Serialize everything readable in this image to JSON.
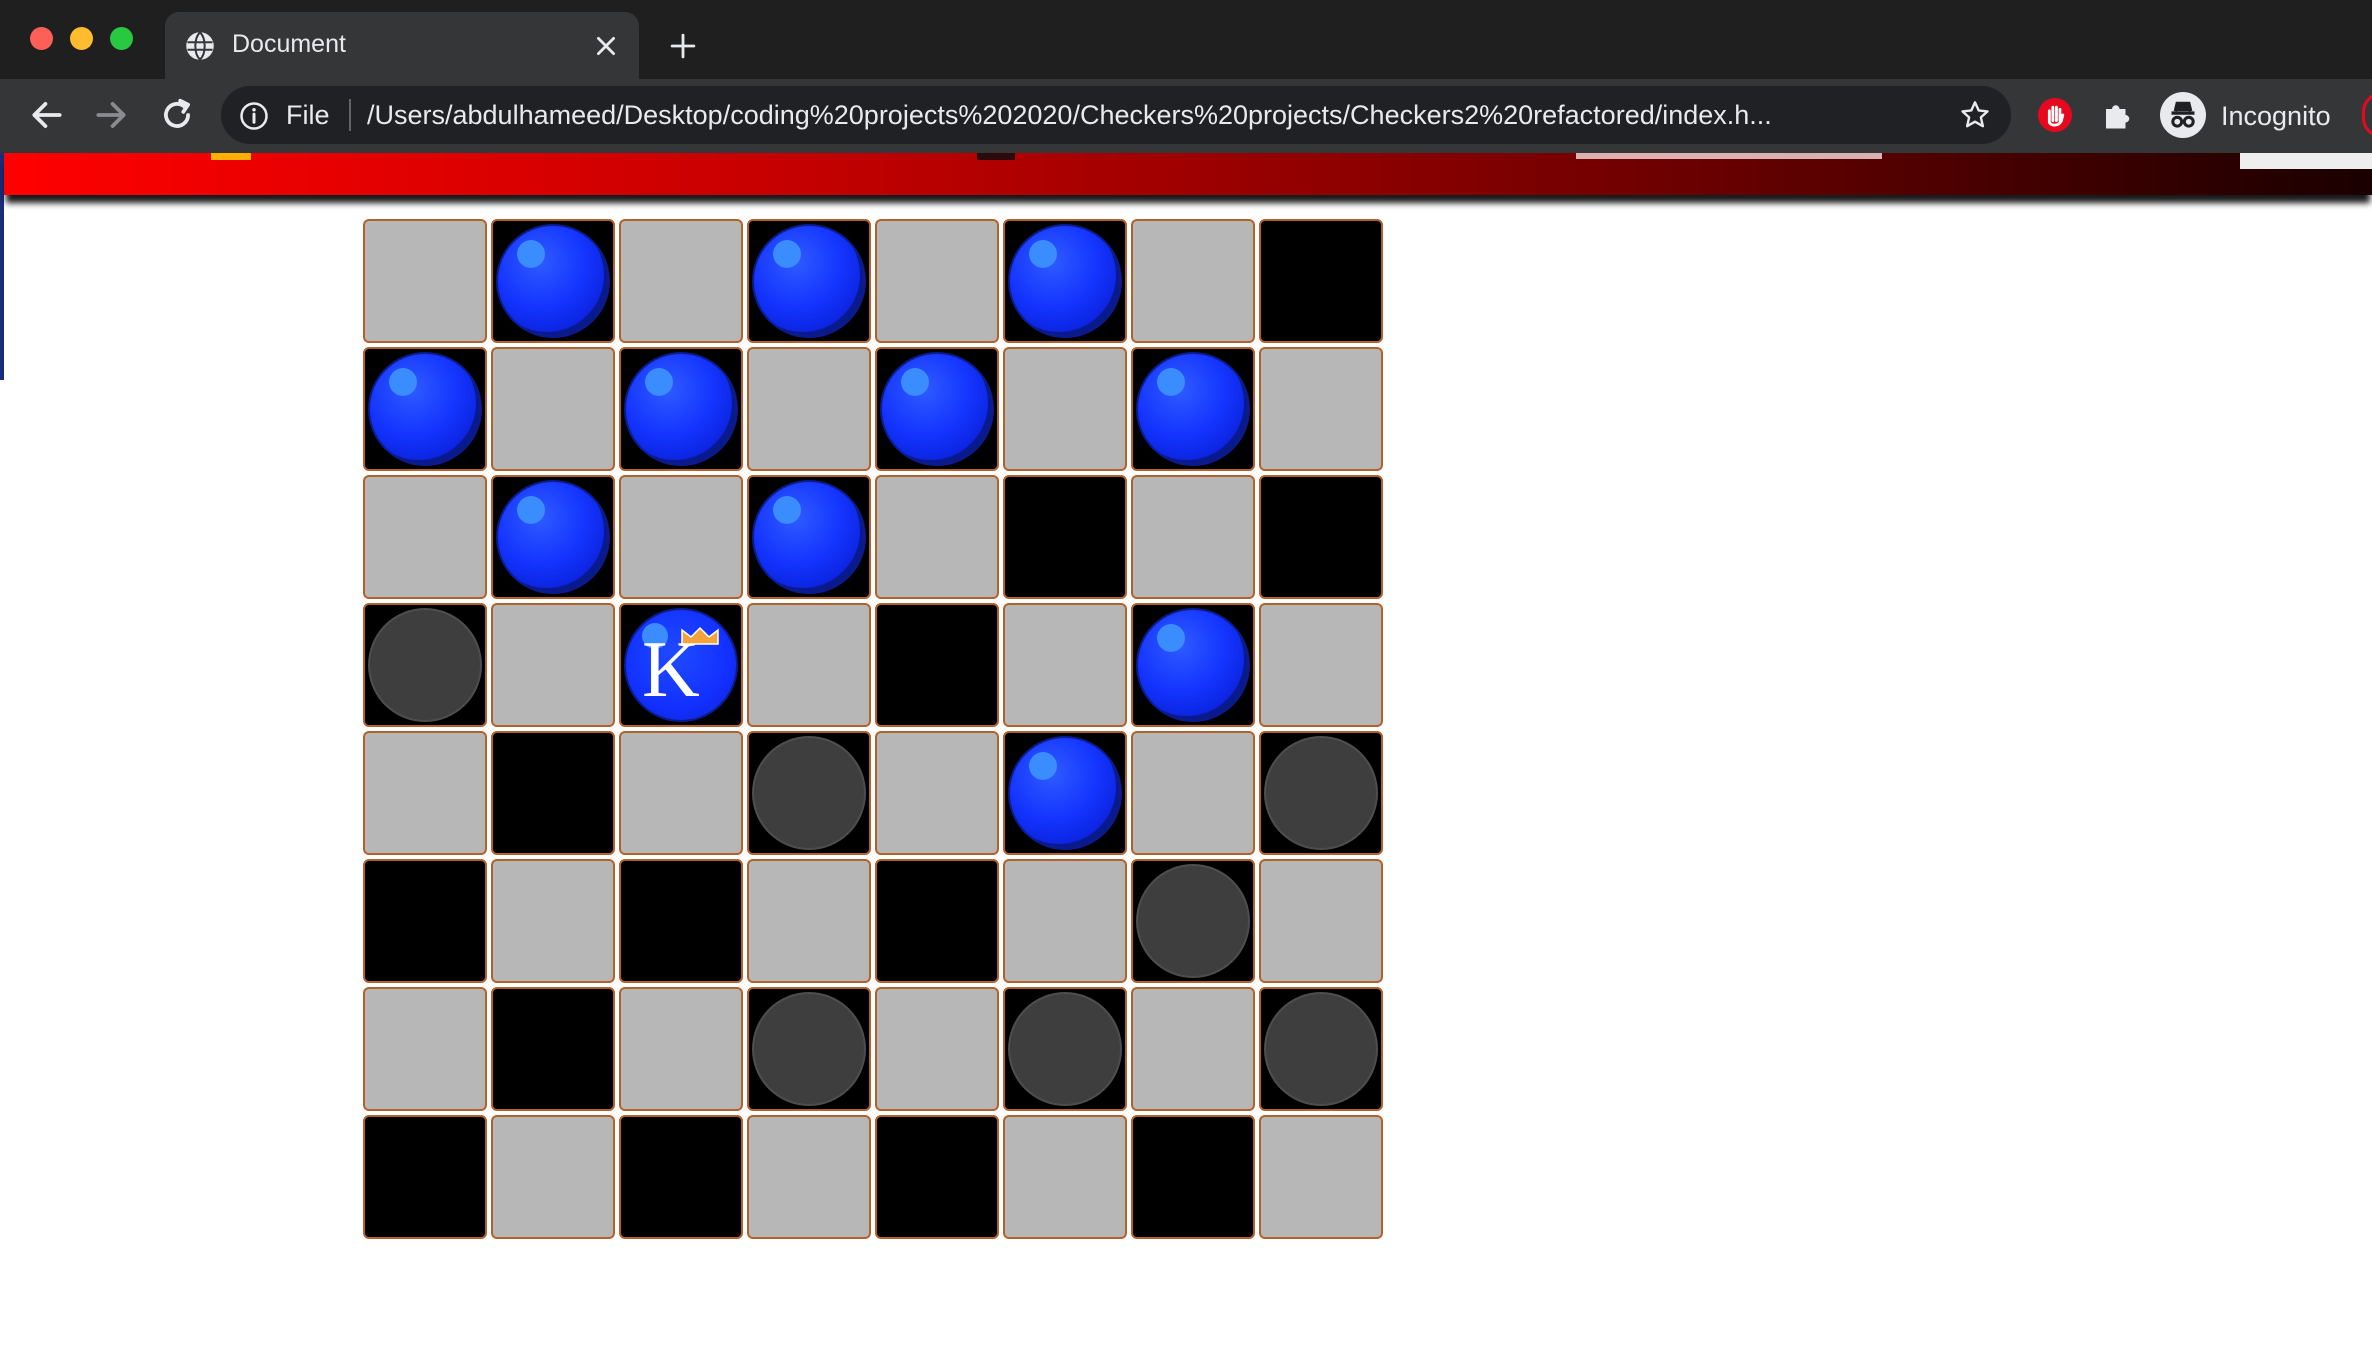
{
  "browser": {
    "tab_title": "Document",
    "url_scheme": "File",
    "url": "/Users/abdulhameed/Desktop/coding%20projects%202020/Checkers%20projects/Checkers2%20refactored/index.h...",
    "incognito_label": "Incognito",
    "icons": {
      "tab": "globe-icon",
      "tab_close": "close-icon",
      "new_tab": "plus-icon",
      "back": "back-arrow-icon",
      "forward": "forward-arrow-icon",
      "reload": "reload-icon",
      "info": "info-icon",
      "bookmark": "star-icon",
      "extension_adblock": "adblock-hand-icon",
      "extensions": "puzzle-icon",
      "incognito": "incognito-icon"
    }
  },
  "colors": {
    "header_gradient_start": "#ff0000",
    "header_gradient_end": "#1a0000",
    "light_square": "#b7b7b7",
    "dark_square": "#000000",
    "square_border": "#b5622a",
    "blue_piece": "#1435ff",
    "grey_piece": "#3e3e3e"
  },
  "board": {
    "rows": [
      [
        "L",
        "D-blue",
        "L",
        "D-blue",
        "L",
        "D-blue",
        "L",
        "D"
      ],
      [
        "D-blue",
        "L",
        "D-blue",
        "L",
        "D-blue",
        "L",
        "D-blue",
        "L"
      ],
      [
        "L",
        "D-blue",
        "L",
        "D-blue",
        "L",
        "D",
        "L",
        "D"
      ],
      [
        "D-grey",
        "L",
        "D-king",
        "L",
        "D",
        "L",
        "D-blue",
        "L"
      ],
      [
        "L",
        "D",
        "L",
        "D-grey",
        "L",
        "D-blue",
        "L",
        "D-grey"
      ],
      [
        "D",
        "L",
        "D",
        "L",
        "D",
        "L",
        "D-grey",
        "L"
      ],
      [
        "L",
        "D",
        "L",
        "D-grey",
        "L",
        "D-grey",
        "L",
        "D-grey"
      ],
      [
        "D",
        "L",
        "D",
        "L",
        "D",
        "L",
        "D",
        "L"
      ]
    ],
    "king_label": "K"
  }
}
